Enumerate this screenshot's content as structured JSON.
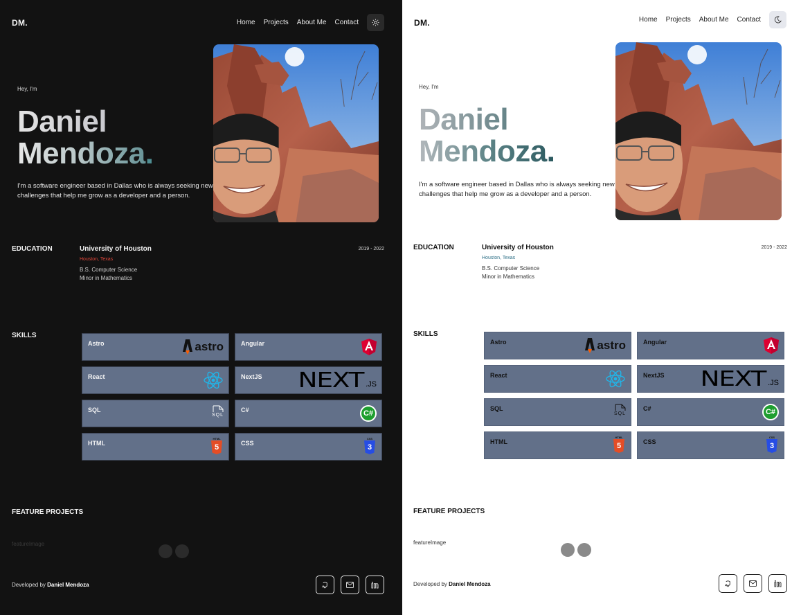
{
  "brand": {
    "logo": "DM."
  },
  "nav": {
    "home": "Home",
    "projects": "Projects",
    "about": "About Me",
    "contact": "Contact"
  },
  "hero": {
    "greeting": "Hey, I'm",
    "first_name": "Daniel",
    "last_name": "Mendoza",
    "dot": ".",
    "intro": "I'm a software engineer based in Dallas who is always seeking new challenges that help me grow as a developer and a person."
  },
  "education": {
    "label": "EDUCATION",
    "school": "University of Houston",
    "location": "Houston, Texas",
    "degree": "B.S. Computer Science",
    "minor": "Minor in Mathematics",
    "years": "2019 - 2022"
  },
  "skills": {
    "label": "SKILLS",
    "items": [
      {
        "name": "Astro",
        "icon": "astro-logo"
      },
      {
        "name": "Angular",
        "icon": "angular-logo"
      },
      {
        "name": "React",
        "icon": "react-logo"
      },
      {
        "name": "NextJS",
        "icon": "nextjs-logo"
      },
      {
        "name": "SQL",
        "icon": "sql-file-icon"
      },
      {
        "name": "C#",
        "icon": "csharp-logo"
      },
      {
        "name": "HTML",
        "icon": "html5-logo"
      },
      {
        "name": "CSS",
        "icon": "css3-logo"
      }
    ],
    "logo_text": {
      "astro": "astro",
      "next": "NEXT",
      "js": ".JS",
      "sql": "SQL",
      "csharp": "C#",
      "html_tag": "HTML",
      "html_num": "5",
      "css_tag": "CSS",
      "css_num": "3"
    }
  },
  "features": {
    "label": "FEATURE PROJECTS",
    "image_alt": "featureImage"
  },
  "footer": {
    "prefix": "Developed by ",
    "author": "Daniel Mendoza"
  },
  "colors": {
    "skill_card": "#627089",
    "dark_bg": "#121212",
    "light_bg": "#ffffff",
    "accent_teal": "#4f8e93"
  },
  "theme_icons": {
    "dark_panel": "sun-icon",
    "light_panel": "moon-icon"
  },
  "social_icons": [
    "github-icon",
    "mail-icon",
    "linkedin-icon"
  ]
}
